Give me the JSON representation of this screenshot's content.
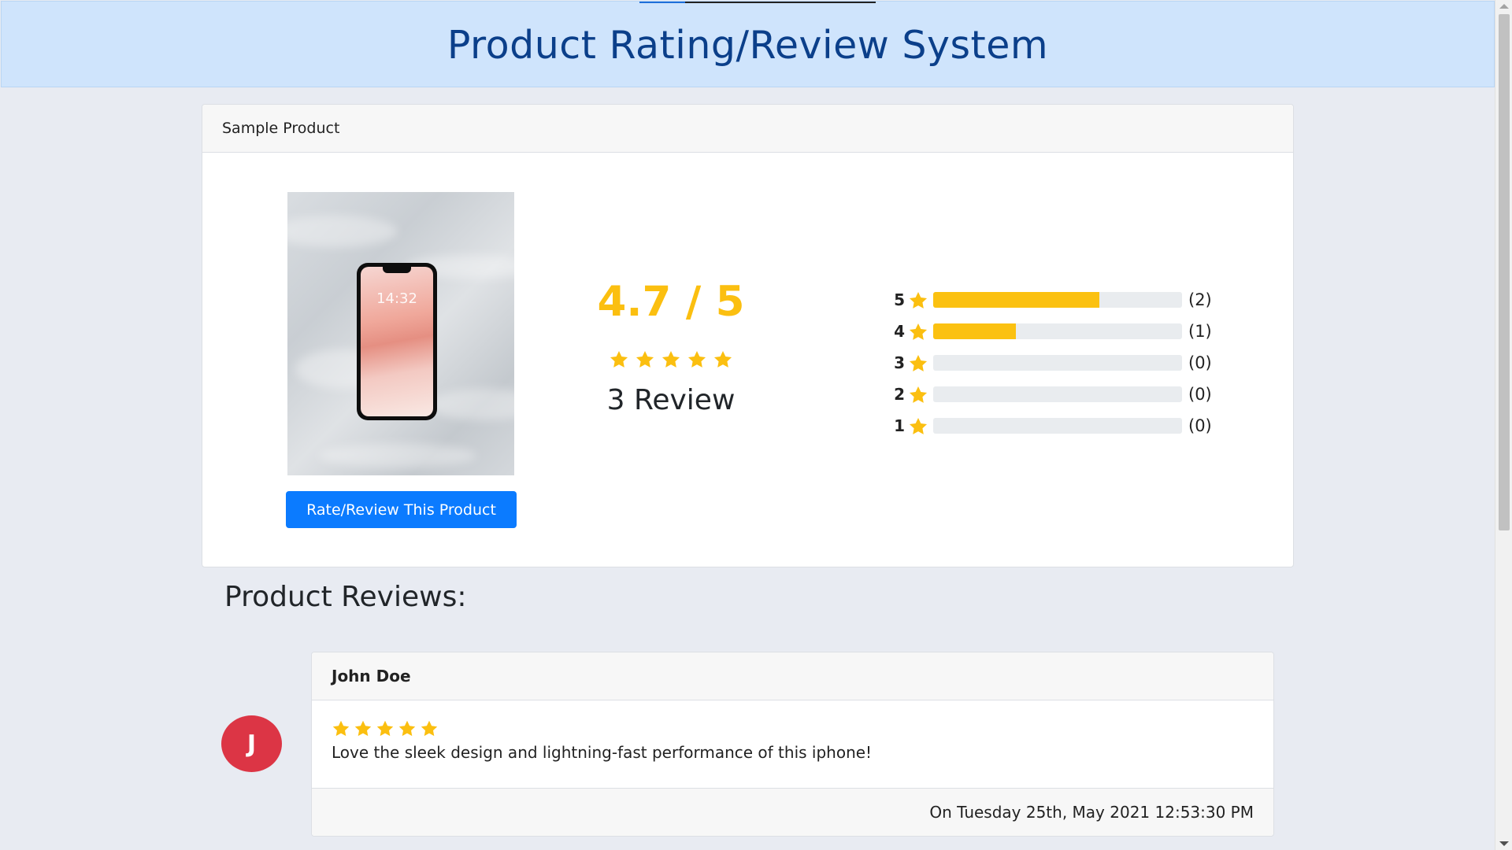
{
  "header": {
    "title": "Product Rating/Review System"
  },
  "product": {
    "name": "Sample Product",
    "phone_time": "14:32",
    "rate_button_label": "Rate/Review This Product"
  },
  "summary": {
    "average": "4.7 / 5",
    "stars_filled": 5,
    "review_count_text": "3 Review"
  },
  "breakdown": [
    {
      "stars": "5",
      "count_text": "(2)",
      "fraction": 0.667
    },
    {
      "stars": "4",
      "count_text": "(1)",
      "fraction": 0.333
    },
    {
      "stars": "3",
      "count_text": "(0)",
      "fraction": 0
    },
    {
      "stars": "2",
      "count_text": "(0)",
      "fraction": 0
    },
    {
      "stars": "1",
      "count_text": "(0)",
      "fraction": 0
    }
  ],
  "reviews_section": {
    "heading": "Product Reviews:"
  },
  "reviews": [
    {
      "avatar_initial": "J",
      "author": "John Doe",
      "stars": 5,
      "text": "Love the sleek design and lightning-fast performance of this iphone!",
      "date": "On Tuesday 25th, May 2021 12:53:30 PM"
    }
  ],
  "colors": {
    "star": "#fbbf10",
    "bar_fill": "#fbc111",
    "primary_button": "#0b7bff",
    "avatar": "#dc3545",
    "header_bg": "#cfe4fc",
    "header_text": "#0b3f8a"
  },
  "icons": {
    "star": "star-icon"
  }
}
